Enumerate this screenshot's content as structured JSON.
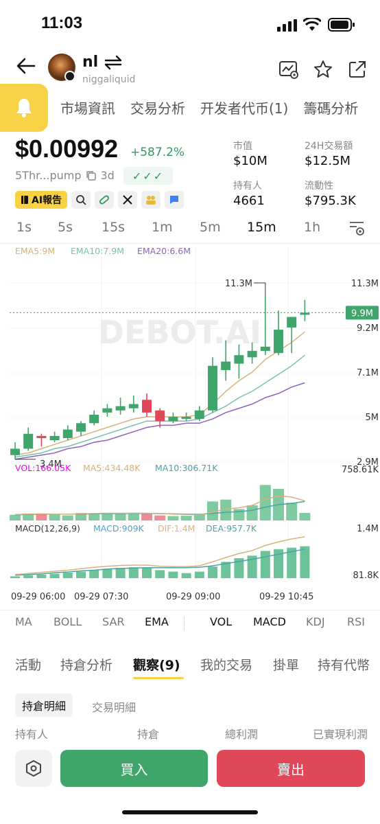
{
  "status": {
    "time": "11:03"
  },
  "token": {
    "name": "nl",
    "handle": "niggaliquid"
  },
  "top_tabs": [
    "市場資訊",
    "交易分析",
    "开发者代币(1)",
    "籌碼分析"
  ],
  "price": {
    "value": "$0.00992",
    "change": "+587.2%"
  },
  "address": {
    "short": "5Thr...pump",
    "age": "3d",
    "checks": "✓✓✓"
  },
  "stats": {
    "mcap_label": "市值",
    "mcap": "$10M",
    "vol_label": "24H交易額",
    "vol": "$12.5M",
    "holders_label": "持有人",
    "holders": "4661",
    "liq_label": "流動性",
    "liq": "$795.3K"
  },
  "tools": {
    "ai_label": "AI報告"
  },
  "timeframes": [
    "1s",
    "5s",
    "15s",
    "1m",
    "5m",
    "15m",
    "1h"
  ],
  "active_timeframe": "15m",
  "chart_data": {
    "type": "candlestick",
    "watermark": "DEBOT.AI",
    "ema_legend": [
      "EMA5:9M",
      "EMA10:7.9M",
      "EMA20:6.6M"
    ],
    "price_ticks": [
      "11.3M",
      "9.2M",
      "7.1M",
      "5M",
      "2.9M"
    ],
    "current_price_label": "9.9M",
    "high_marker": "11.3M",
    "low_marker": "3.4M",
    "candles": [
      {
        "o": 3.2,
        "h": 3.8,
        "l": 3.0,
        "c": 3.5
      },
      {
        "o": 3.5,
        "h": 4.5,
        "l": 3.4,
        "c": 4.2
      },
      {
        "o": 4.1,
        "h": 4.2,
        "l": 3.6,
        "c": 4.0
      },
      {
        "o": 3.9,
        "h": 4.3,
        "l": 3.8,
        "c": 4.1
      },
      {
        "o": 4.0,
        "h": 4.6,
        "l": 3.9,
        "c": 4.4
      },
      {
        "o": 4.3,
        "h": 4.8,
        "l": 4.1,
        "c": 4.7
      },
      {
        "o": 4.7,
        "h": 5.3,
        "l": 4.6,
        "c": 5.1
      },
      {
        "o": 5.2,
        "h": 5.6,
        "l": 5.0,
        "c": 5.4
      },
      {
        "o": 5.3,
        "h": 5.9,
        "l": 5.1,
        "c": 5.5
      },
      {
        "o": 5.4,
        "h": 6.0,
        "l": 5.2,
        "c": 5.6
      },
      {
        "o": 5.8,
        "h": 6.1,
        "l": 5.0,
        "c": 5.2
      },
      {
        "o": 5.3,
        "h": 5.4,
        "l": 4.5,
        "c": 4.8
      },
      {
        "o": 4.8,
        "h": 5.2,
        "l": 4.7,
        "c": 5.0
      },
      {
        "o": 4.9,
        "h": 5.2,
        "l": 4.8,
        "c": 5.0
      },
      {
        "o": 4.9,
        "h": 5.5,
        "l": 4.8,
        "c": 5.3
      },
      {
        "o": 5.3,
        "h": 7.8,
        "l": 5.2,
        "c": 7.4
      },
      {
        "o": 7.2,
        "h": 8.6,
        "l": 6.7,
        "c": 7.6
      },
      {
        "o": 7.5,
        "h": 8.4,
        "l": 6.8,
        "c": 7.9
      },
      {
        "o": 7.8,
        "h": 8.5,
        "l": 7.5,
        "c": 8.1
      },
      {
        "o": 8.1,
        "h": 10.6,
        "l": 7.9,
        "c": 8.3
      },
      {
        "o": 8.0,
        "h": 10.0,
        "l": 7.9,
        "c": 9.1
      },
      {
        "o": 9.2,
        "h": 9.7,
        "l": 8.0,
        "c": 9.7
      },
      {
        "o": 9.8,
        "h": 10.5,
        "l": 9.5,
        "c": 9.9
      }
    ],
    "ema5": [
      3.2,
      3.3,
      3.5,
      3.7,
      3.9,
      4.1,
      4.3,
      4.5,
      4.7,
      4.9,
      5.0,
      5.0,
      5.0,
      5.0,
      5.1,
      5.6,
      6.2,
      6.7,
      7.1,
      7.7,
      8.1,
      8.5,
      9.0
    ],
    "ema10": [
      3.1,
      3.2,
      3.3,
      3.5,
      3.6,
      3.8,
      4.0,
      4.2,
      4.4,
      4.6,
      4.8,
      4.8,
      4.8,
      4.8,
      4.9,
      5.2,
      5.5,
      5.9,
      6.2,
      6.6,
      7.0,
      7.4,
      7.9
    ],
    "ema20": [
      3.0,
      3.1,
      3.2,
      3.3,
      3.5,
      3.6,
      3.8,
      3.9,
      4.1,
      4.3,
      4.5,
      4.6,
      4.6,
      4.7,
      4.7,
      4.9,
      5.2,
      5.4,
      5.6,
      5.9,
      6.1,
      6.4,
      6.6
    ],
    "vol_legend": [
      "VOL:166.05K",
      "MA5:434.48K",
      "MA10:306.71K"
    ],
    "vol_max_label": "758.61K",
    "volume": [
      90,
      110,
      110,
      95,
      80,
      120,
      110,
      120,
      110,
      125,
      115,
      80,
      70,
      75,
      100,
      300,
      330,
      180,
      240,
      560,
      500,
      280,
      120
    ],
    "vol_ma5": [
      95,
      100,
      105,
      100,
      100,
      105,
      110,
      115,
      115,
      115,
      115,
      110,
      100,
      95,
      90,
      130,
      180,
      200,
      240,
      330,
      390,
      370,
      310
    ],
    "vol_ma10": [
      90,
      95,
      100,
      100,
      100,
      100,
      105,
      108,
      108,
      110,
      110,
      108,
      105,
      100,
      98,
      110,
      130,
      140,
      160,
      210,
      250,
      270,
      300
    ],
    "macd_legend": [
      "MACD(12,26,9)",
      "MACD:909K",
      "DIF:1.4M",
      "DEA:957.7K"
    ],
    "macd_top_label": "1.4M",
    "macd_bottom_label": "81.8K",
    "macd_hist": [
      0.05,
      0.08,
      0.1,
      0.12,
      0.15,
      0.18,
      0.22,
      0.26,
      0.28,
      0.3,
      0.28,
      0.22,
      0.18,
      0.14,
      0.18,
      0.32,
      0.45,
      0.55,
      0.62,
      0.75,
      0.8,
      0.84,
      0.88
    ],
    "dif": [
      0.1,
      0.13,
      0.16,
      0.19,
      0.22,
      0.26,
      0.3,
      0.33,
      0.35,
      0.36,
      0.36,
      0.33,
      0.32,
      0.32,
      0.34,
      0.45,
      0.57,
      0.68,
      0.76,
      0.9,
      1.0,
      1.08,
      1.14
    ],
    "dea": [
      0.08,
      0.1,
      0.12,
      0.15,
      0.17,
      0.2,
      0.22,
      0.25,
      0.27,
      0.28,
      0.29,
      0.29,
      0.29,
      0.29,
      0.3,
      0.34,
      0.4,
      0.46,
      0.52,
      0.59,
      0.66,
      0.73,
      0.8
    ],
    "x_labels": [
      "09-29 06:00",
      "09-29 07:30",
      "09-29 09:00",
      "09-29 10:45"
    ]
  },
  "indicators": [
    "MA",
    "BOLL",
    "SAR",
    "EMA",
    "VOL",
    "MACD",
    "KDJ",
    "RSI"
  ],
  "bottom_tabs": [
    "活動",
    "持倉分析",
    "觀察(9)",
    "我的交易",
    "掛單",
    "持有代幣"
  ],
  "sub_tabs": [
    "持倉明細",
    "交易明細"
  ],
  "columns": [
    "持有人",
    "持倉",
    "總利潤",
    "已實現利潤"
  ],
  "actions": {
    "buy": "買入",
    "sell": "賣出"
  },
  "colors": {
    "up": "#3fa56b",
    "down": "#e0485a",
    "ema5": "#d8b27a",
    "ema10": "#7bbfb0",
    "ema20": "#8d62bd",
    "vol_ma5": "#d8b27a",
    "vol_ma10": "#4aa3a8",
    "dif": "#d8b27a",
    "dea": "#4aa3a8",
    "accent": "#f7d244"
  }
}
